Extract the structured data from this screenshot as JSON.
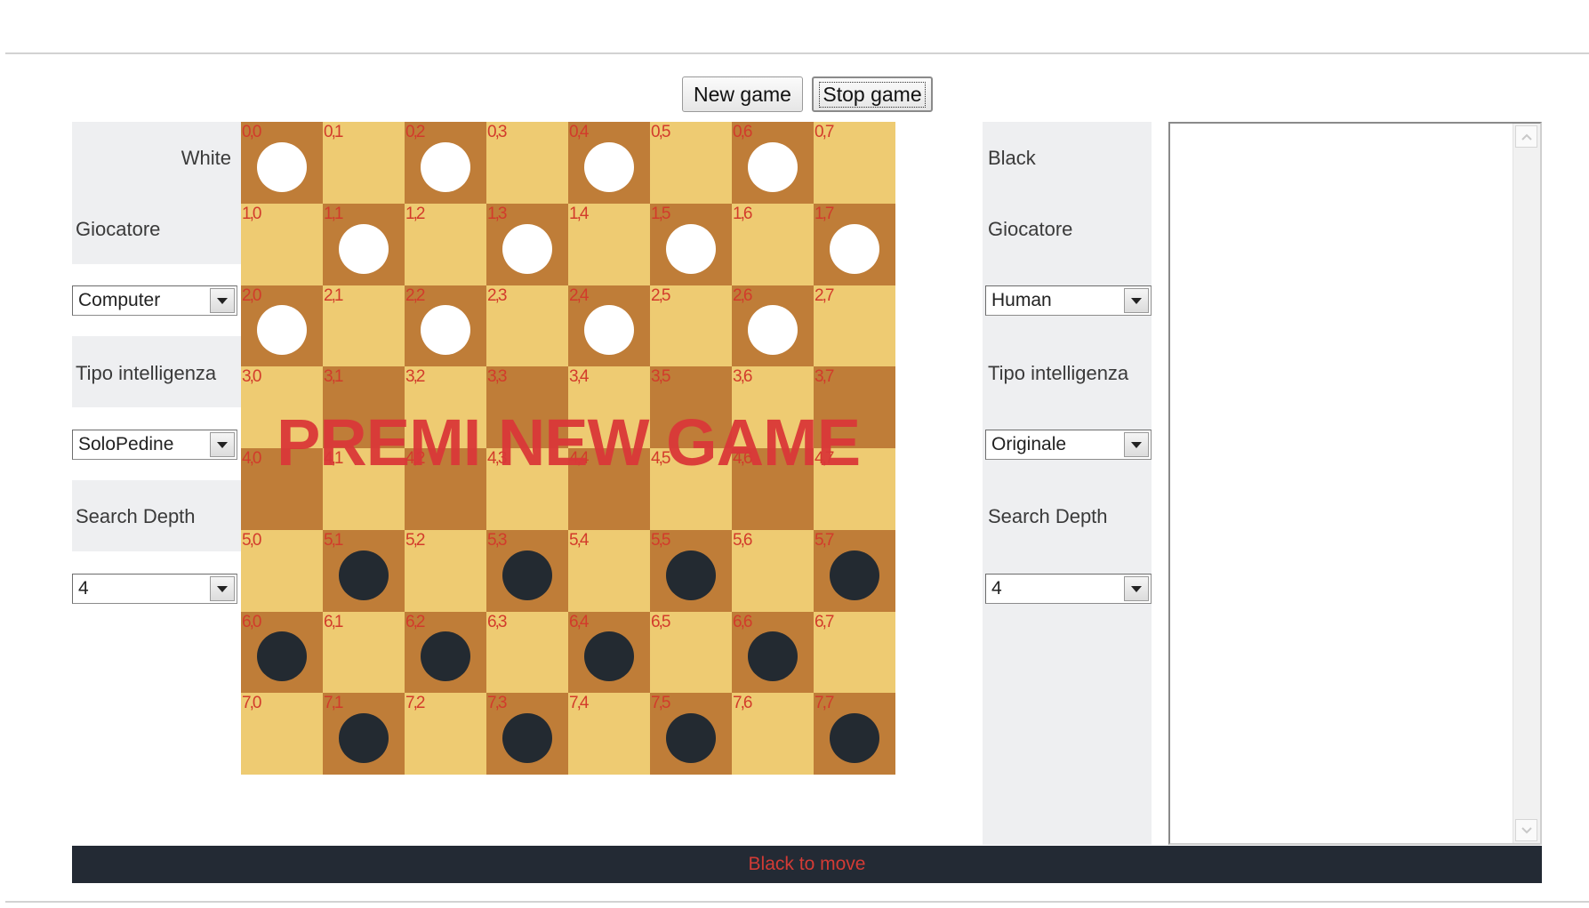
{
  "toolbar": {
    "new_game_label": "New game",
    "stop_game_label": "Stop game"
  },
  "white_panel": {
    "title": "White",
    "player_label": "Giocatore",
    "player_value": "Computer",
    "intelligence_label": "Tipo intelligenza",
    "intelligence_value": "SoloPedine",
    "depth_label": "Search Depth",
    "depth_value": "4"
  },
  "black_panel": {
    "title": "Black",
    "player_label": "Giocatore",
    "player_value": "Human",
    "intelligence_label": "Tipo intelligenza",
    "intelligence_value": "Originale",
    "depth_label": "Search Depth",
    "depth_value": "4"
  },
  "board": {
    "rows": 8,
    "cols": 8,
    "overlay_text": "PREMI NEW GAME",
    "white_pieces": [
      "0,0",
      "0,2",
      "0,4",
      "0,6",
      "1,1",
      "1,3",
      "1,5",
      "1,7",
      "2,0",
      "2,2",
      "2,4",
      "2,6"
    ],
    "black_pieces": [
      "5,1",
      "5,3",
      "5,5",
      "5,7",
      "6,0",
      "6,2",
      "6,4",
      "6,6",
      "7,1",
      "7,3",
      "7,5",
      "7,7"
    ],
    "colors": {
      "dark": "#bf7d38",
      "light": "#eecb72",
      "coord": "#d23b2b",
      "white_piece": "#ffffff",
      "black_piece": "#232a31"
    }
  },
  "status": {
    "text": "Black to move"
  }
}
